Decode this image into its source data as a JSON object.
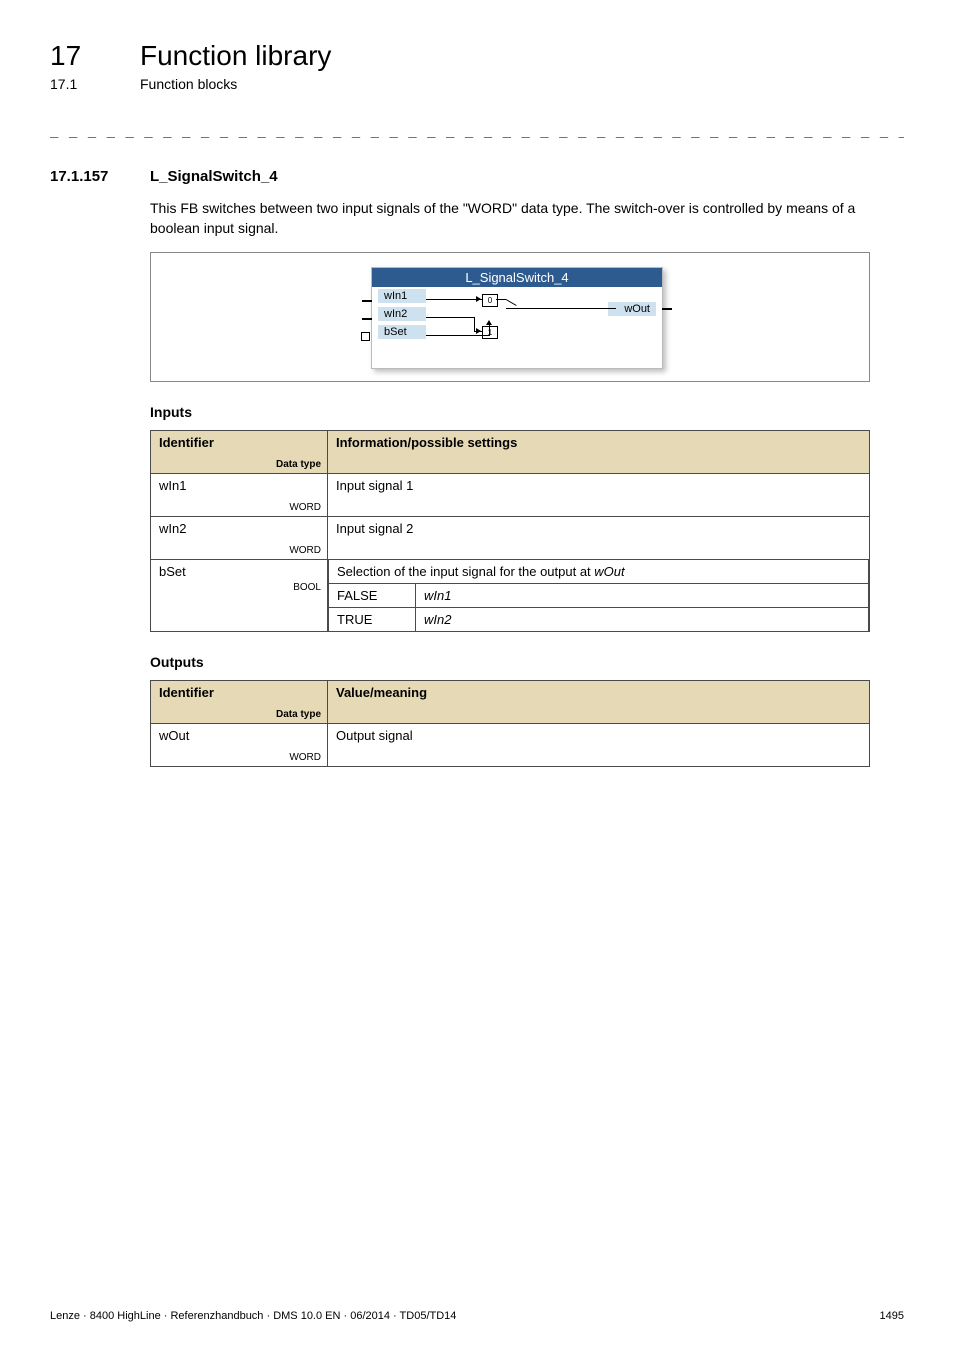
{
  "header": {
    "chapter_num": "17",
    "chapter_title": "Function library",
    "sub_num": "17.1",
    "sub_title": "Function blocks"
  },
  "separator": "_ _ _ _ _ _ _ _ _ _ _ _ _ _ _ _ _ _ _ _ _ _ _ _ _ _ _ _ _ _ _ _ _ _ _ _ _ _ _ _ _ _ _ _ _ _ _ _ _ _ _ _ _ _ _ _ _ _ _ _ _ _ _ _",
  "section": {
    "num": "17.1.157",
    "name": "L_SignalSwitch_4",
    "description": "This FB switches between two input signals of the \"WORD\" data type. The switch-over is controlled by means of a boolean input signal."
  },
  "diagram": {
    "title": "L_SignalSwitch_4",
    "in1": "wIn1",
    "in2": "wIn2",
    "set": "bSet",
    "out": "wOut",
    "zero": "0",
    "one": "1"
  },
  "inputs": {
    "heading": "Inputs",
    "col_id": "Identifier",
    "col_info": "Information/possible settings",
    "dt_label": "Data type",
    "rows": [
      {
        "name": "wIn1",
        "type": "WORD",
        "desc": "Input signal 1"
      },
      {
        "name": "wIn2",
        "type": "WORD",
        "desc": "Input signal 2"
      }
    ],
    "bset": {
      "name": "bSet",
      "type": "BOOL",
      "desc": "Selection of the input signal for the output at wOut",
      "desc_ital": "wOut",
      "false_label": "FALSE",
      "false_val": "wIn1",
      "true_label": "TRUE",
      "true_val": "wIn2"
    }
  },
  "outputs": {
    "heading": "Outputs",
    "col_id": "Identifier",
    "col_val": "Value/meaning",
    "dt_label": "Data type",
    "row": {
      "name": "wOut",
      "type": "WORD",
      "desc": "Output signal"
    }
  },
  "footer": {
    "left": "Lenze · 8400 HighLine · Referenzhandbuch · DMS 10.0 EN · 06/2014 · TD05/TD14",
    "right": "1495"
  }
}
